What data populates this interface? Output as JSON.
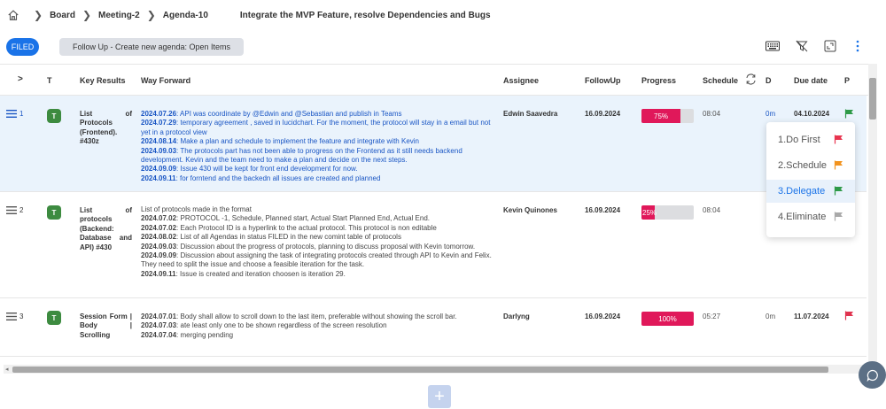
{
  "breadcrumb": {
    "items": [
      "Board",
      "Meeting-2",
      "Agenda-10"
    ],
    "title": "Integrate the MVP Feature, resolve Dependencies and Bugs"
  },
  "toolbar": {
    "filed_label": "FILED",
    "followup_label": "Follow Up - Create new agenda: Open Items",
    "icons": [
      "keyboard-icon",
      "filter-off-icon",
      "expand-icon",
      "more-vertical-icon"
    ]
  },
  "table": {
    "headers": {
      "expand": ">",
      "t": "T",
      "key_results": "Key Results",
      "way_forward": "Way Forward",
      "assignee": "Assignee",
      "followup": "FollowUp",
      "progress": "Progress",
      "schedule": "Schedule",
      "d": "D",
      "due_date": "Due date",
      "p": "P"
    },
    "rows": [
      {
        "num": "1",
        "t": "T",
        "key_result": "List of Protocols (Frontend). #430z",
        "way_forward": [
          {
            "date": "2024.07.26",
            "text": ":  API was coordinate by @Edwin and @Sebastian and publish in Teams"
          },
          {
            "date": "2024.07.29",
            "text": ":  temporary agreement , saved in lucidchart. For the moment, the protocol will stay in a email but not yet in a protocol view"
          },
          {
            "date": "2024.08.14",
            "text": ":  Make a plan and schedule to implement the feature and integrate with Kevin"
          },
          {
            "date": "2024.09.03",
            "text": ": The protocols part has not been able to progress on the Frontend as it still needs backend development. Kevin and the team need to make a plan and decide on the next steps."
          },
          {
            "date": "2024.09.09",
            "text": ": Issue 430 will be kept for front end development for now."
          },
          {
            "date": "2024.09.11",
            "text": ":  for forntend and the backedn all issues are created and planned"
          }
        ],
        "assignee": "Edwin Saavedra",
        "followup": "16.09.2024",
        "progress": 75,
        "progress_label": "75%",
        "schedule": "08:04",
        "d": "0m",
        "due_date": "04.10.2024",
        "priority_color": "#2e9a48"
      },
      {
        "num": "2",
        "t": "T",
        "key_result": "List of protocols (Backend: Database and API) #430",
        "way_forward": [
          {
            "date": "",
            "text": "List of protocols made in the format"
          },
          {
            "date": "2024.07.02",
            "text": ":  PROTOCOL -1, Schedule, Planned start, Actual Start Planned End, Actual End."
          },
          {
            "date": "2024.07.02",
            "text": ":  Each Protocol ID is a hyperlink to the actual protocol. This protocol is non editable"
          },
          {
            "date": "2024.08.02",
            "text": ":  List of all Agendas in status FILED in the new comint table of protocols"
          },
          {
            "date": "2024.09.03",
            "text": ": Discussion about the progress of protocols, planning to discuss proposal with Kevin tomorrow."
          },
          {
            "date": "2024.09.09",
            "text": ": Discussion about assigning the task of integrating protocols created through API to Kevin and Felix. They need to split the issue and choose a feasible iteration for the task."
          },
          {
            "date": "2024.09.11",
            "text": ":  Issue is created and iteration choosen is iteration 29."
          }
        ],
        "assignee": "Kevin Quinones",
        "followup": "16.09.2024",
        "progress": 25,
        "progress_label": "25%",
        "schedule": "08:04",
        "d": "",
        "due_date": "",
        "priority_color": ""
      },
      {
        "num": "3",
        "t": "T",
        "key_result": "Session Form | Body | Scrolling",
        "way_forward": [
          {
            "date": "2024.07.01",
            "text": ":  Body shall allow to scroll down to the last item, preferable without showing the scroll bar."
          },
          {
            "date": "2024.07.03",
            "text": ":  ate least only one to be shown regardless of the screen resolution"
          },
          {
            "date": "2024.07.04",
            "text": ":  merging pending"
          }
        ],
        "assignee": "Darlyng",
        "followup": "16.09.2024",
        "progress": 100,
        "progress_label": "100%",
        "schedule": "05:27",
        "d": "0m",
        "due_date": "11.07.2024",
        "priority_color": "#e0334f"
      }
    ]
  },
  "priority_menu": {
    "items": [
      {
        "label": "1.Do First",
        "color": "#e8354f"
      },
      {
        "label": "2.Schedule",
        "color": "#f2931e"
      },
      {
        "label": "3.Delegate",
        "color": "#2e9a48"
      },
      {
        "label": "4.Eliminate",
        "color": "#a9a9a9"
      }
    ],
    "selected_index": 2
  },
  "add_button_label": "+"
}
